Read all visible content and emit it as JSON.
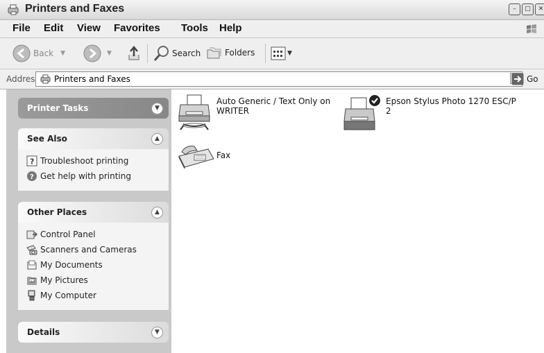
{
  "window": {
    "title": "Printers and Faxes"
  },
  "menu": [
    "File",
    "Edit",
    "View",
    "Favorites",
    "Tools",
    "Help"
  ],
  "toolbar": {
    "back": "Back",
    "search": "Search",
    "folders": "Folders"
  },
  "address": {
    "label": "Address",
    "value": "Printers and Faxes",
    "go": "Go"
  },
  "tasks": {
    "printer_tasks": {
      "title": "Printer Tasks"
    },
    "see_also": {
      "title": "See Also",
      "items": [
        "Troubleshoot printing",
        "Get help with printing"
      ]
    },
    "other_places": {
      "title": "Other Places",
      "items": [
        "Control Panel",
        "Scanners and Cameras",
        "My Documents",
        "My Pictures",
        "My Computer"
      ]
    },
    "details": {
      "title": "Details"
    }
  },
  "items": [
    {
      "name_line1": "Auto Generic / Text Only on",
      "name_line2": "WRITER",
      "icon": "shared-printer-icon"
    },
    {
      "name_line1": "Epson Stylus Photo 1270 ESC/P",
      "name_line2": "2",
      "icon": "default-printer-icon"
    },
    {
      "name_line1": "Fax",
      "name_line2": "",
      "icon": "fax-icon"
    }
  ]
}
